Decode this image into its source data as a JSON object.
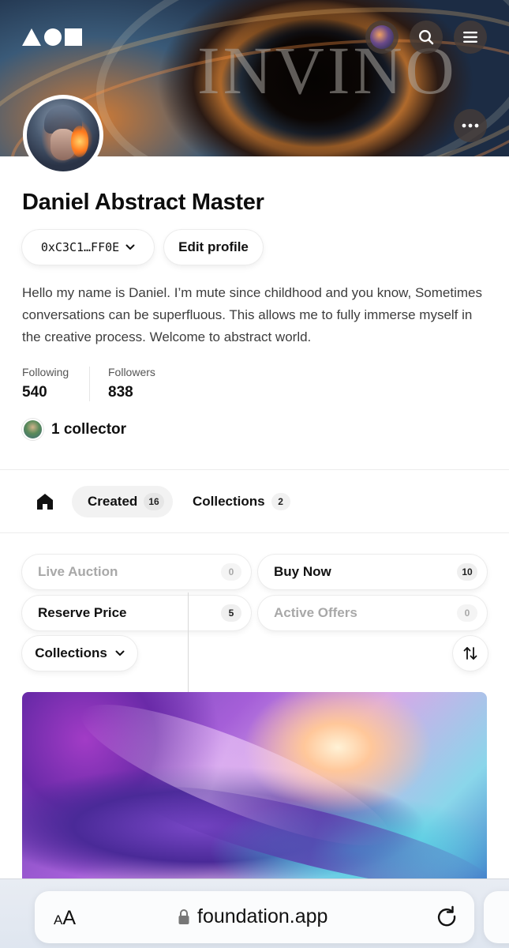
{
  "banner": {
    "watermark_text": "INVINO"
  },
  "header": {
    "logo_icon": "foundation-logo-icon",
    "avatar_icon": "user-avatar-icon",
    "search_icon": "search-icon",
    "menu_icon": "hamburger-menu-icon"
  },
  "profile": {
    "name": "Daniel Abstract Master",
    "address": "0xC3C1…FF0E",
    "edit_label": "Edit profile",
    "bio": "Hello my name is Daniel. I’m mute since childhood and you know, Sometimes conversations can be superfluous. This allows me to fully immerse myself in the creative process. Welcome to abstract world.",
    "following_label": "Following",
    "following_value": "540",
    "followers_label": "Followers",
    "followers_value": "838",
    "collector_text": "1 collector"
  },
  "tabs": {
    "created_label": "Created",
    "created_count": "16",
    "collections_label": "Collections",
    "collections_count": "2"
  },
  "filters": {
    "live_auction_label": "Live Auction",
    "live_auction_count": "0",
    "buy_now_label": "Buy Now",
    "buy_now_count": "10",
    "reserve_price_label": "Reserve Price",
    "reserve_price_count": "5",
    "active_offers_label": "Active Offers",
    "active_offers_count": "0",
    "collections_dropdown_label": "Collections"
  },
  "browser": {
    "text_size_label": "AA",
    "url": "foundation.app"
  },
  "colors": {
    "text_primary": "#111111",
    "text_disabled": "#a8a8a8",
    "badge_bg": "#e6e6e6",
    "browser_bar": "#e4e9f1"
  }
}
